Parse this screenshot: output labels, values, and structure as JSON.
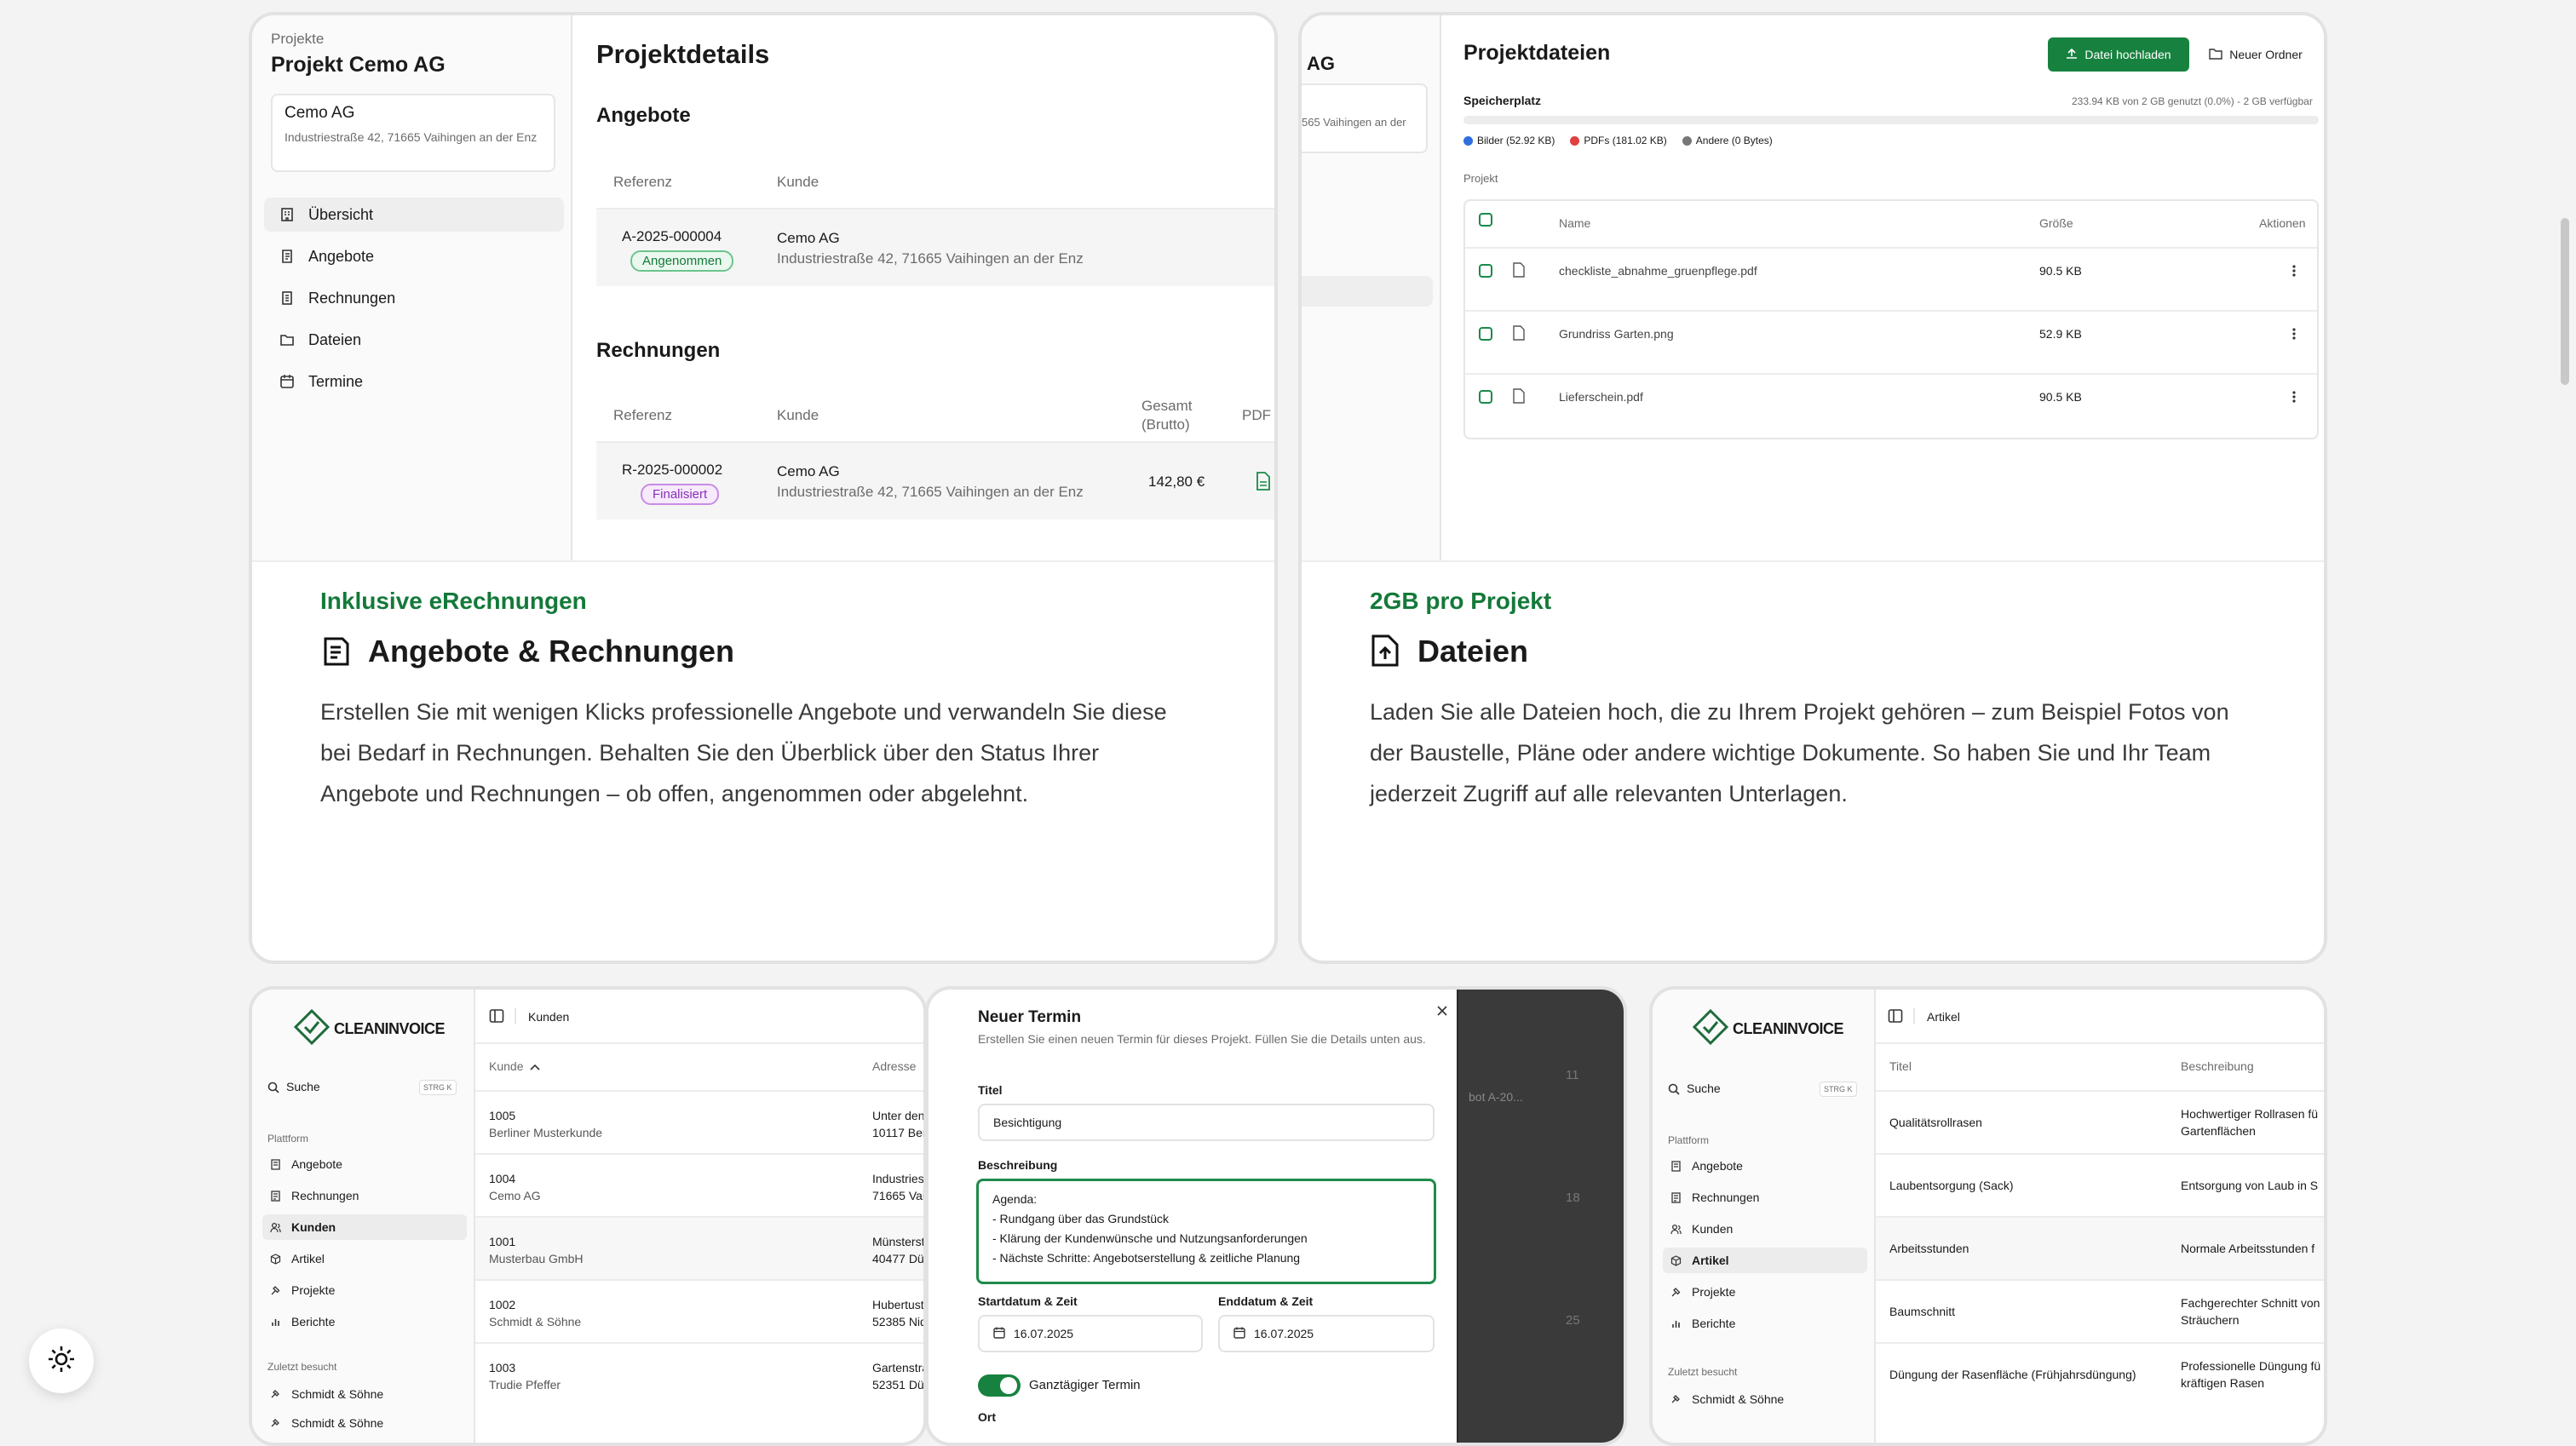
{
  "card1": {
    "breadcrumb": "Projekte",
    "project_title": "Projekt Cemo AG",
    "client_name": "Cemo AG",
    "client_address": "Industriestraße 42, 71665 Vaihingen an der Enz",
    "nav": [
      {
        "label": "Übersicht",
        "icon": "building-icon"
      },
      {
        "label": "Angebote",
        "icon": "receipt-icon"
      },
      {
        "label": "Rechnungen",
        "icon": "invoice-icon"
      },
      {
        "label": "Dateien",
        "icon": "folder-icon"
      },
      {
        "label": "Termine",
        "icon": "calendar-icon"
      }
    ],
    "details_title": "Projektdetails",
    "offers_title": "Angebote",
    "offers_headers": [
      "Referenz",
      "Kunde"
    ],
    "offer_row": {
      "ref": "A-2025-000004",
      "status": "Angenommen",
      "client": "Cemo AG",
      "address": "Industriestraße 42, 71665 Vaihingen an der Enz"
    },
    "invoices_title": "Rechnungen",
    "invoices_headers": [
      "Referenz",
      "Kunde",
      "Gesamt (Brutto)",
      "PDF"
    ],
    "invoice_row": {
      "ref": "R-2025-000002",
      "status": "Finalisiert",
      "client": "Cemo AG",
      "address": "Industriestraße 42, 71665 Vaihingen an der Enz",
      "total": "142,80 €"
    },
    "eyebrow": "Inklusive eRechnungen",
    "feature_title": "Angebote & Rechnungen",
    "feature_text": "Erstellen Sie mit wenigen Klicks professionelle Angebote und verwandeln Sie diese bei Bedarf in Rechnungen. Behalten Sie den Überblick über den Status Ihrer Angebote und Rechnungen – ob offen, angenommen oder abgelehnt."
  },
  "card2": {
    "side_title_fragment": "AG",
    "side_address_fragment": "565 Vaihingen an der",
    "title": "Projektdateien",
    "upload_label": "Datei hochladen",
    "new_folder_label": "Neuer Ordner",
    "storage_label": "Speicherplatz",
    "storage_usage": "233.94 KB von 2 GB genutzt (0.0%) - 2 GB verfügbar",
    "storage_used_fraction": 0.0,
    "legend": [
      {
        "label": "Bilder (52.92 KB)",
        "color": "#2f6fe0"
      },
      {
        "label": "PDFs (181.02 KB)",
        "color": "#e04040"
      },
      {
        "label": "Andere (0 Bytes)",
        "color": "#777777"
      }
    ],
    "section_label": "Projekt",
    "headers": [
      "Name",
      "Größe",
      "Aktionen"
    ],
    "files": [
      {
        "name": "checkliste_abnahme_gruenpflege.pdf",
        "size": "90.5 KB"
      },
      {
        "name": "Grundriss Garten.png",
        "size": "52.9 KB"
      },
      {
        "name": "Lieferschein.pdf",
        "size": "90.5 KB"
      }
    ],
    "eyebrow": "2GB pro Projekt",
    "feature_title": "Dateien",
    "feature_text": "Laden Sie alle Dateien hoch, die zu Ihrem Projekt gehören – zum Beispiel Fotos von der Baustelle, Pläne oder andere wichtige Dokumente. So haben Sie und Ihr Team jederzeit Zugriff auf alle relevanten Unterlagen."
  },
  "card3": {
    "brand": "CLEANINVOICE",
    "search_label": "Suche",
    "search_shortcut": "STRG K",
    "platform_label": "Plattform",
    "nav": [
      {
        "label": "Angebote",
        "icon": "receipt-icon"
      },
      {
        "label": "Rechnungen",
        "icon": "invoice-icon"
      },
      {
        "label": "Kunden",
        "icon": "users-icon"
      },
      {
        "label": "Artikel",
        "icon": "box-icon"
      },
      {
        "label": "Projekte",
        "icon": "hammer-icon"
      },
      {
        "label": "Berichte",
        "icon": "chart-icon"
      }
    ],
    "recent_label": "Zuletzt besucht",
    "recent": [
      "Schmidt & Söhne",
      "Schmidt & Söhne"
    ],
    "page_title": "Kunden",
    "headers": [
      "Kunde",
      "Adresse"
    ],
    "rows": [
      {
        "id": "1005",
        "name": "Berliner Musterkunde",
        "addr1": "Unter den",
        "addr2": "10117 Berl"
      },
      {
        "id": "1004",
        "name": "Cemo AG",
        "addr1": "Industries",
        "addr2": "71665 Vai"
      },
      {
        "id": "1001",
        "name": "Musterbau GmbH",
        "addr1": "Münsterst",
        "addr2": "40477 Düs"
      },
      {
        "id": "1002",
        "name": "Schmidt & Söhne",
        "addr1": "Hubertust",
        "addr2": "52385 Nid"
      },
      {
        "id": "1003",
        "name": "Trudie Pfeffer",
        "addr1": "Gartenstra",
        "addr2": "52351 Dür"
      }
    ]
  },
  "card4": {
    "title": "Neuer Termin",
    "subtitle": "Erstellen Sie einen neuen Termin für dieses Projekt. Füllen Sie die Details unten aus.",
    "title_label": "Titel",
    "title_value": "Besichtigung",
    "desc_label": "Beschreibung",
    "desc_lines": [
      "Agenda:",
      "- Rundgang über das Grundstück",
      "- Klärung der Kundenwünsche und Nutzungsanforderungen",
      "- Nächste Schritte: Angebotserstellung & zeitliche Planung"
    ],
    "start_label": "Startdatum & Zeit",
    "start_value": "16.07.2025",
    "end_label": "Enddatum & Zeit",
    "end_value": "16.07.2025",
    "allday_label": "Ganztägiger Termin",
    "location_label": "Ort",
    "backdrop_texts": [
      "11",
      "bot A-20...",
      "18",
      "25"
    ]
  },
  "card5": {
    "brand": "CLEANINVOICE",
    "search_label": "Suche",
    "search_shortcut": "STRG K",
    "platform_label": "Plattform",
    "nav": [
      {
        "label": "Angebote",
        "icon": "receipt-icon"
      },
      {
        "label": "Rechnungen",
        "icon": "invoice-icon"
      },
      {
        "label": "Kunden",
        "icon": "users-icon"
      },
      {
        "label": "Artikel",
        "icon": "box-icon"
      },
      {
        "label": "Projekte",
        "icon": "hammer-icon"
      },
      {
        "label": "Berichte",
        "icon": "chart-icon"
      }
    ],
    "recent_label": "Zuletzt besucht",
    "recent": [
      "Schmidt & Söhne"
    ],
    "page_title": "Artikel",
    "headers": [
      "Titel",
      "Beschreibung"
    ],
    "rows": [
      {
        "title": "Qualitätsrollrasen",
        "desc1": "Hochwertiger Rollrasen fü",
        "desc2": "Gartenflächen"
      },
      {
        "title": "Laubentsorgung (Sack)",
        "desc1": "Entsorgung von Laub in S",
        "desc2": ""
      },
      {
        "title": "Arbeitsstunden",
        "desc1": "Normale Arbeitsstunden f",
        "desc2": ""
      },
      {
        "title": "Baumschnitt",
        "desc1": "Fachgerechter Schnitt von",
        "desc2": "Sträuchern"
      },
      {
        "title": "Düngung der Rasenfläche (Frühjahrsdüngung)",
        "desc1": "Professionelle Düngung fü",
        "desc2": "kräftigen Rasen"
      }
    ]
  },
  "theme_toggle_icon": "sun-icon"
}
